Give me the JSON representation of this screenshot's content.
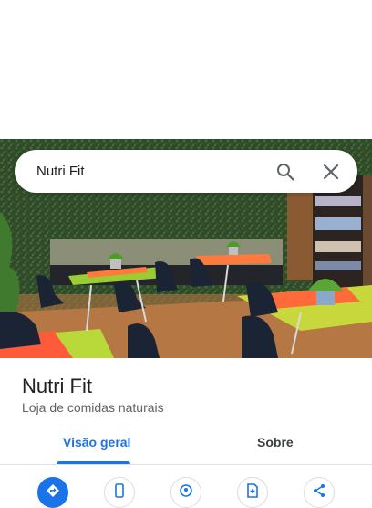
{
  "search": {
    "query": "Nutri Fit"
  },
  "place": {
    "name": "Nutri Fit",
    "category": "Loja de comidas naturais"
  },
  "tabs": [
    {
      "label": "Visão geral",
      "selected": true
    },
    {
      "label": "Sobre",
      "selected": false
    }
  ],
  "colors": {
    "accent": "#1a73e8"
  },
  "actions": [
    {
      "icon": "directions-icon"
    },
    {
      "icon": "phone-icon"
    },
    {
      "icon": "location-pin-icon"
    },
    {
      "icon": "add-document-icon"
    },
    {
      "icon": "share-icon"
    }
  ]
}
